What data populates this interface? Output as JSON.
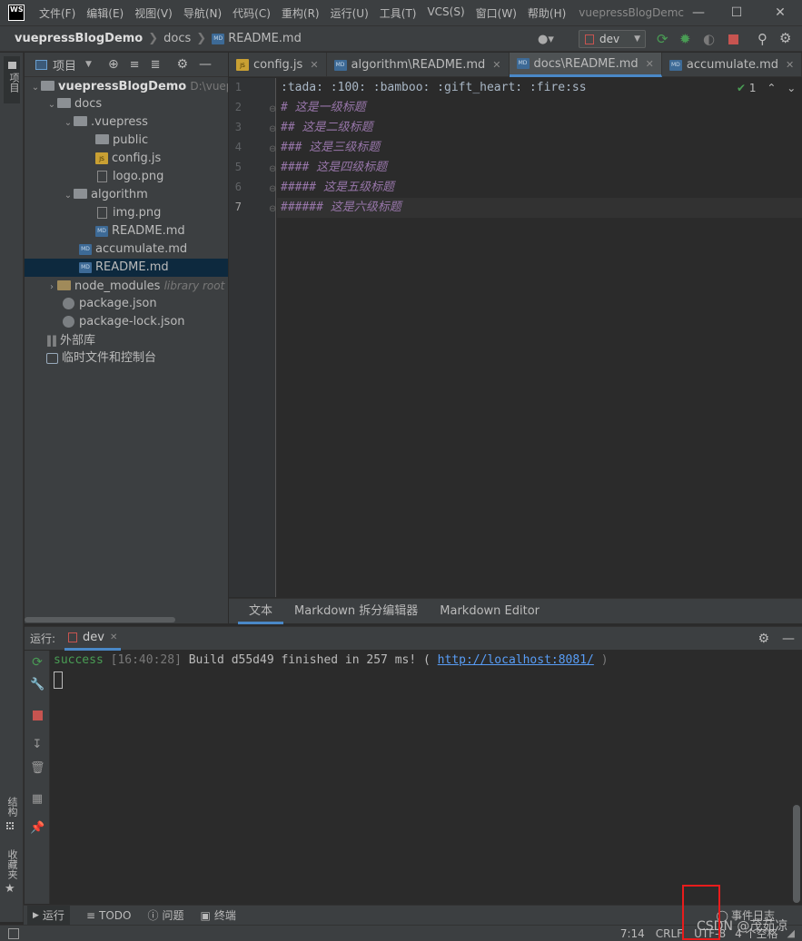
{
  "window": {
    "logo": "WS",
    "title": "vuepressBlogDemc",
    "menu": [
      "文件(F)",
      "编辑(E)",
      "视图(V)",
      "导航(N)",
      "代码(C)",
      "重构(R)",
      "运行(U)",
      "工具(T)",
      "VCS(S)",
      "窗口(W)",
      "帮助(H)"
    ]
  },
  "navbar": {
    "project": "vuepressBlogDemo",
    "folder": "docs",
    "file": "README.md",
    "run_config": "dev"
  },
  "left_stripe": {
    "project_label": "项目",
    "structure_label": "结构",
    "favorites_label": "收藏夹"
  },
  "project_panel": {
    "title": "项目",
    "root_name": "vuepressBlogDemo",
    "root_path": "D:\\vuepre",
    "items": {
      "docs": "docs",
      "vuepress": ".vuepress",
      "public": "public",
      "configjs": "config.js",
      "logo": "logo.png",
      "algorithm": "algorithm",
      "img": "img.png",
      "alg_readme": "README.md",
      "accumulate": "accumulate.md",
      "readme": "README.md",
      "node_modules": "node_modules",
      "node_modules_hint": "library root",
      "package": "package.json",
      "package_lock": "package-lock.json",
      "external": "外部库",
      "scratches": "临时文件和控制台"
    }
  },
  "tabs": [
    {
      "label": "config.js",
      "icon": "js"
    },
    {
      "label": "algorithm\\README.md",
      "icon": "md"
    },
    {
      "label": "docs\\README.md",
      "icon": "md",
      "active": true
    },
    {
      "label": "accumulate.md",
      "icon": "md"
    }
  ],
  "editor": {
    "line_numbers": [
      "1",
      "2",
      "3",
      "4",
      "5",
      "6",
      "7"
    ],
    "lines": [
      ":tada: :100: :bamboo: :gift_heart: :fire:ss",
      "# 这是一级标题",
      "## 这是二级标题",
      "### 这是三级标题",
      "#### 这是四级标题",
      "##### 这是五级标题",
      "###### 这是六级标题"
    ],
    "inspection_count": "1",
    "bottom_tabs": [
      "文本",
      "Markdown 拆分编辑器",
      "Markdown Editor"
    ]
  },
  "run_panel": {
    "label": "运行:",
    "config": "dev",
    "console": {
      "status": "success",
      "time": "[16:40:28]",
      "message": "Build d55d49 finished in 257 ms! (",
      "url": "http://localhost:8081/",
      "close_paren": ")"
    }
  },
  "bottom_tools": [
    "运行",
    "TODO",
    "问题",
    "终端"
  ],
  "event_log": "事件日志",
  "status": {
    "position": "7:14",
    "line_sep": "CRLF",
    "encoding": "UTF-8",
    "indent": "4 个空格"
  },
  "watermark": "CSDN @茂茹凉",
  "colors": {
    "accent": "#4a88c7",
    "success": "#499c54",
    "link": "#589df6",
    "stop": "#c75450",
    "highlight_box": "#e81c1c"
  }
}
